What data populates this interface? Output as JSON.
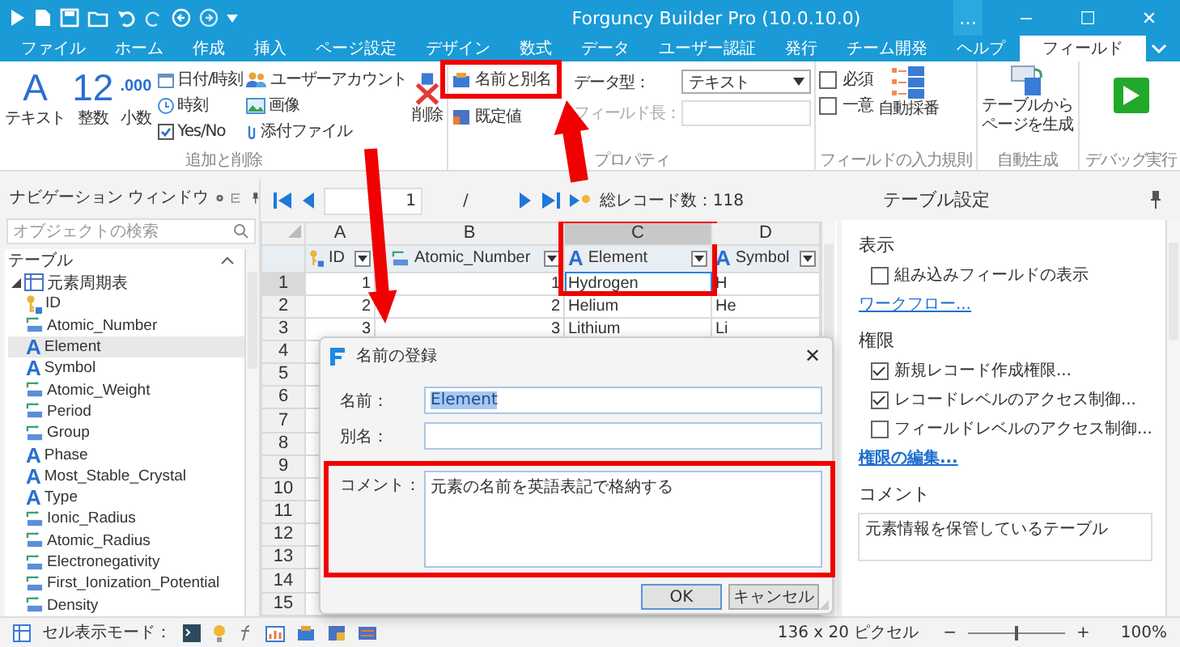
{
  "title_bar": {
    "title": "Forguncy Builder Pro (10.0.10.0)",
    "controls": [
      "…",
      "−",
      "☐",
      "✕"
    ]
  },
  "tabs": [
    {
      "label": "ファイル",
      "selected": false
    },
    {
      "label": "ホーム",
      "selected": false
    },
    {
      "label": "作成",
      "selected": false
    },
    {
      "label": "挿入",
      "selected": false
    },
    {
      "label": "ページ設定",
      "selected": false
    },
    {
      "label": "デザイン",
      "selected": false
    },
    {
      "label": "数式",
      "selected": false
    },
    {
      "label": "データ",
      "selected": false
    },
    {
      "label": "ユーザー認証",
      "selected": false
    },
    {
      "label": "発行",
      "selected": false
    },
    {
      "label": "チーム開発",
      "selected": false
    },
    {
      "label": "ヘルプ",
      "selected": false
    },
    {
      "label": "フィールド",
      "selected": true
    }
  ],
  "ribbon": {
    "add_delete": {
      "label": "追加と削除",
      "types": [
        {
          "label": "テキスト",
          "glyph": "A"
        },
        {
          "label": "整数",
          "glyph": "12"
        },
        {
          "label": "小数",
          "glyph": ".000"
        }
      ],
      "small_columns": [
        [
          {
            "label": "日付/時刻",
            "kind": "date"
          },
          {
            "label": "時刻",
            "kind": "time"
          },
          {
            "label": "Yes/No",
            "kind": "yesno"
          }
        ],
        [
          {
            "label": "ユーザーアカウント",
            "kind": "user"
          },
          {
            "label": "画像",
            "kind": "image"
          },
          {
            "label": "添付ファイル",
            "kind": "attachment"
          }
        ]
      ],
      "delete": "削除"
    },
    "properties": {
      "label": "プロパティ",
      "name_alias": "名前と別名",
      "default_value": "既定値",
      "data_type_label": "データ型：",
      "data_type_value": "テキスト",
      "field_length_label": "フィールド長：",
      "field_length_disabled": true
    },
    "validation": {
      "label": "フィールドの入力規則",
      "checks": [
        {
          "label": "必須",
          "checked": false
        },
        {
          "label": "一意",
          "checked": false
        }
      ],
      "auto_number": "自動採番"
    },
    "auto_generate": {
      "label": "自動生成",
      "button_lines": [
        "テーブルから",
        "ページを生成"
      ]
    },
    "debug": {
      "label": "デバッグ実行"
    }
  },
  "nav_panel": {
    "title": "ナビゲーション ウィンドウ",
    "search": {
      "placeholder": "オブジェクトの検索"
    },
    "section": "テーブル",
    "tree": [
      {
        "label": "元素周期表",
        "expanded": true,
        "selected": false,
        "children": [
          {
            "label": "ID",
            "kind": "key",
            "selected": false
          },
          {
            "label": "Atomic_Number",
            "kind": "number",
            "selected": false
          },
          {
            "label": "Element",
            "kind": "text",
            "icon": "A",
            "selected": true
          },
          {
            "label": "Symbol",
            "kind": "text",
            "icon": "A",
            "selected": false
          },
          {
            "label": "Atomic_Weight",
            "kind": "number",
            "selected": false
          },
          {
            "label": "Period",
            "kind": "number",
            "selected": false
          },
          {
            "label": "Group",
            "kind": "number",
            "selected": false
          },
          {
            "label": "Phase",
            "kind": "text",
            "icon": "A",
            "selected": false
          },
          {
            "label": "Most_Stable_Crystal",
            "kind": "text",
            "icon": "A",
            "selected": false
          },
          {
            "label": "Type",
            "kind": "text",
            "icon": "A",
            "selected": false
          },
          {
            "label": "Ionic_Radius",
            "kind": "number",
            "selected": false
          },
          {
            "label": "Atomic_Radius",
            "kind": "number",
            "selected": false
          },
          {
            "label": "Electronegativity",
            "kind": "number",
            "selected": false
          },
          {
            "label": "First_Ionization_Potential",
            "kind": "number",
            "selected": false
          },
          {
            "label": "Density",
            "kind": "number",
            "selected": false
          }
        ]
      }
    ]
  },
  "grid": {
    "toolbar": {
      "page": "1",
      "separator": "/",
      "total": "総レコード数：118"
    },
    "columns": [
      {
        "letter": "A",
        "field": "ID",
        "kind": "key",
        "selected": false
      },
      {
        "letter": "B",
        "field": "Atomic_Number",
        "kind": "number",
        "selected": false
      },
      {
        "letter": "C",
        "field": "Element",
        "kind": "text",
        "icon": "A",
        "selected": true
      },
      {
        "letter": "D",
        "field": "Symbol",
        "kind": "text",
        "icon": "A",
        "selected": false
      }
    ],
    "rows": [
      {
        "num": "1",
        "cells": [
          "1",
          "1",
          "Hydrogen",
          "H"
        ],
        "selected": true
      },
      {
        "num": "2",
        "cells": [
          "2",
          "2",
          "Helium",
          "He"
        ],
        "selected": false
      },
      {
        "num": "3",
        "cells": [
          "3",
          "3",
          "Lithium",
          "Li"
        ],
        "selected": false
      },
      {
        "num": "4",
        "selected": false
      },
      {
        "num": "5",
        "selected": false
      },
      {
        "num": "6",
        "selected": false
      },
      {
        "num": "7",
        "selected": false
      },
      {
        "num": "8",
        "selected": false
      },
      {
        "num": "9",
        "selected": false
      },
      {
        "num": "10",
        "selected": false
      },
      {
        "num": "11",
        "selected": false
      },
      {
        "num": "12",
        "selected": false
      },
      {
        "num": "13",
        "selected": false
      },
      {
        "num": "14",
        "selected": false
      },
      {
        "num": "15",
        "selected": false
      }
    ]
  },
  "dialog": {
    "title": "名前の登録",
    "close": "✕",
    "fields": [
      {
        "label": "名前：",
        "value": "Element",
        "kind": "line",
        "text_selected": true
      },
      {
        "label": "別名：",
        "kind": "line"
      },
      {
        "label": "コメント：",
        "value": "元素の名前を英語表記で格納する",
        "kind": "multiline",
        "text_selected": false
      }
    ],
    "buttons": [
      {
        "label": "OK",
        "primary": true
      },
      {
        "label": "キャンセル",
        "primary": false
      }
    ]
  },
  "right_panel": {
    "title": "テーブル設定",
    "sections": [
      {
        "heading": "表示",
        "items": [
          {
            "kind": "checkbox",
            "label": "組み込みフィールドの表示",
            "checked": false
          },
          {
            "kind": "link",
            "label": "ワークフロー..."
          }
        ]
      },
      {
        "heading": "権限",
        "items": [
          {
            "kind": "checkbox",
            "label": "新規レコード作成権限...",
            "checked": true
          },
          {
            "kind": "checkbox",
            "label": "レコードレベルのアクセス制御...",
            "checked": true
          },
          {
            "kind": "checkbox",
            "label": "フィールドレベルのアクセス制御...",
            "checked": false
          },
          {
            "kind": "link",
            "label": "権限の編集..."
          }
        ]
      },
      {
        "heading": "コメント",
        "items": [
          {
            "kind": "textarea",
            "value": "元素情報を保管しているテーブル"
          }
        ]
      }
    ]
  },
  "status_bar": {
    "mode_label": "セル表示モード：",
    "size": "136 x 20 ピクセル",
    "zoom": {
      "minus": "−",
      "plus": "+",
      "level": 0.5,
      "reading": "100%"
    }
  }
}
